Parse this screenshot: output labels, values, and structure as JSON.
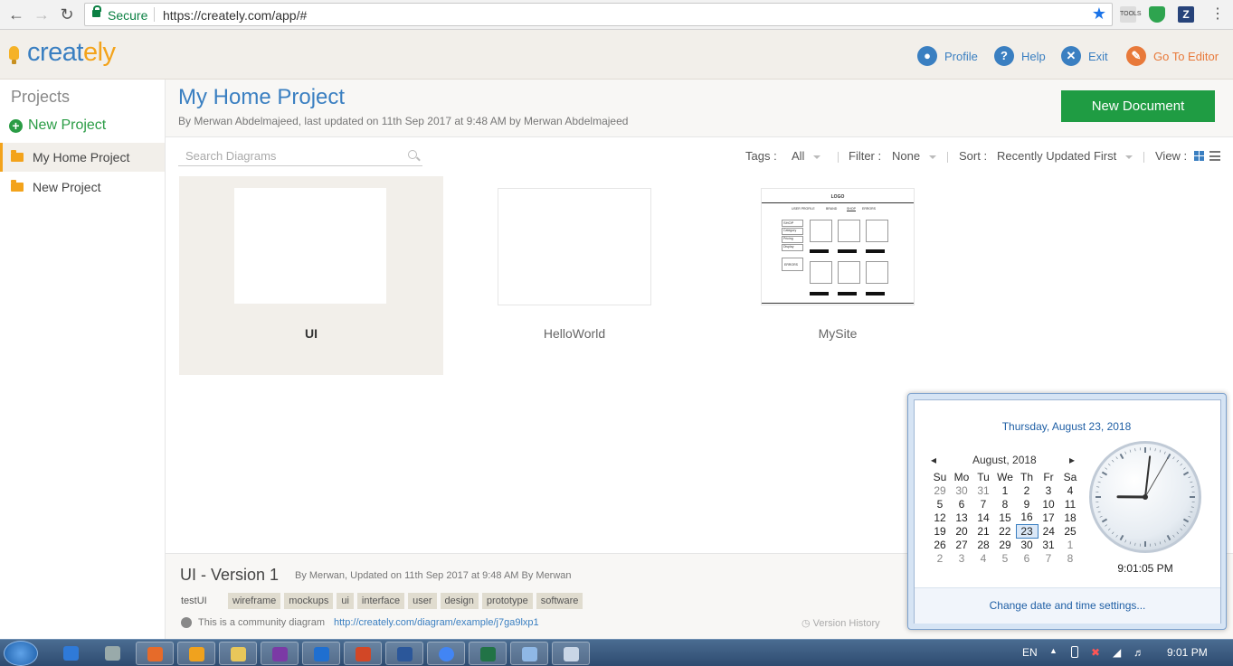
{
  "browser": {
    "secure_label": "Secure",
    "url": "https://creately.com/app/#",
    "ext_labels": [
      "TOOLS",
      "Z"
    ]
  },
  "app": {
    "logo": "creately",
    "nav": {
      "profile": "Profile",
      "help": "Help",
      "exit": "Exit",
      "editor": "Go To Editor"
    }
  },
  "sidebar": {
    "title": "Projects",
    "new_project": "New Project",
    "items": [
      {
        "label": "My Home Project"
      },
      {
        "label": "New Project"
      }
    ]
  },
  "project": {
    "title": "My Home Project",
    "subtitle": "By Merwan Abdelmajeed, last updated on 11th Sep 2017 at 9:48 AM by Merwan Abdelmajeed",
    "new_document": "New Document"
  },
  "toolbar": {
    "search_placeholder": "Search Diagrams",
    "tags_label": "Tags :",
    "tags_value": "All",
    "filter_label": "Filter :",
    "filter_value": "None",
    "sort_label": "Sort :",
    "sort_value": "Recently Updated First",
    "view_label": "View :"
  },
  "documents": [
    {
      "name": "UI"
    },
    {
      "name": "HelloWorld"
    },
    {
      "name": "MySite"
    }
  ],
  "mysite_thumb": {
    "logo": "LOGO",
    "nav": [
      "USER PROFILE",
      "BRAND",
      "SHOP",
      "ERRORS"
    ],
    "side": [
      "SHOP",
      "Category",
      "Pricing",
      "Display",
      "ERRORS"
    ],
    "product_btn": "Add to cart"
  },
  "detail": {
    "title": "UI - Version 1",
    "byline": "By Merwan, Updated on 11th Sep 2017 at 9:48 AM By Merwan",
    "doc_name": "testUI",
    "tags": [
      "wireframe",
      "mockups",
      "ui",
      "interface",
      "user",
      "design",
      "prototype",
      "software"
    ],
    "community_text": "This is a community diagram",
    "community_link": "http://creately.com/diagram/example/j7ga9lxp1",
    "version_history": "Version History"
  },
  "calendar": {
    "long_date": "Thursday, August 23, 2018",
    "month": "August, 2018",
    "weekdays": [
      "Su",
      "Mo",
      "Tu",
      "We",
      "Th",
      "Fr",
      "Sa"
    ],
    "weeks": [
      [
        "29",
        "30",
        "31",
        "1",
        "2",
        "3",
        "4"
      ],
      [
        "5",
        "6",
        "7",
        "8",
        "9",
        "10",
        "11"
      ],
      [
        "12",
        "13",
        "14",
        "15",
        "16",
        "17",
        "18"
      ],
      [
        "19",
        "20",
        "21",
        "22",
        "23",
        "24",
        "25"
      ],
      [
        "26",
        "27",
        "28",
        "29",
        "30",
        "31",
        "1"
      ],
      [
        "2",
        "3",
        "4",
        "5",
        "6",
        "7",
        "8"
      ]
    ],
    "today": "23",
    "time": "9:01:05 PM",
    "clock": {
      "hours": 21,
      "minutes": 1,
      "seconds": 5
    },
    "change_settings": "Change date and time settings..."
  },
  "taskbar": {
    "lang": "EN",
    "time": "9:01 PM",
    "apps": [
      "ie-icon",
      "user-icon",
      "firefox-icon",
      "media-icon",
      "explorer-icon",
      "onenote-icon",
      "outlook-icon",
      "powerpoint-icon",
      "word-icon",
      "chrome-icon",
      "excel-icon",
      "folder-icon",
      "paint-icon"
    ]
  },
  "colors": {
    "brand_blue": "#3a7fc1",
    "brand_orange": "#f3a31b",
    "green": "#1f9c43"
  }
}
